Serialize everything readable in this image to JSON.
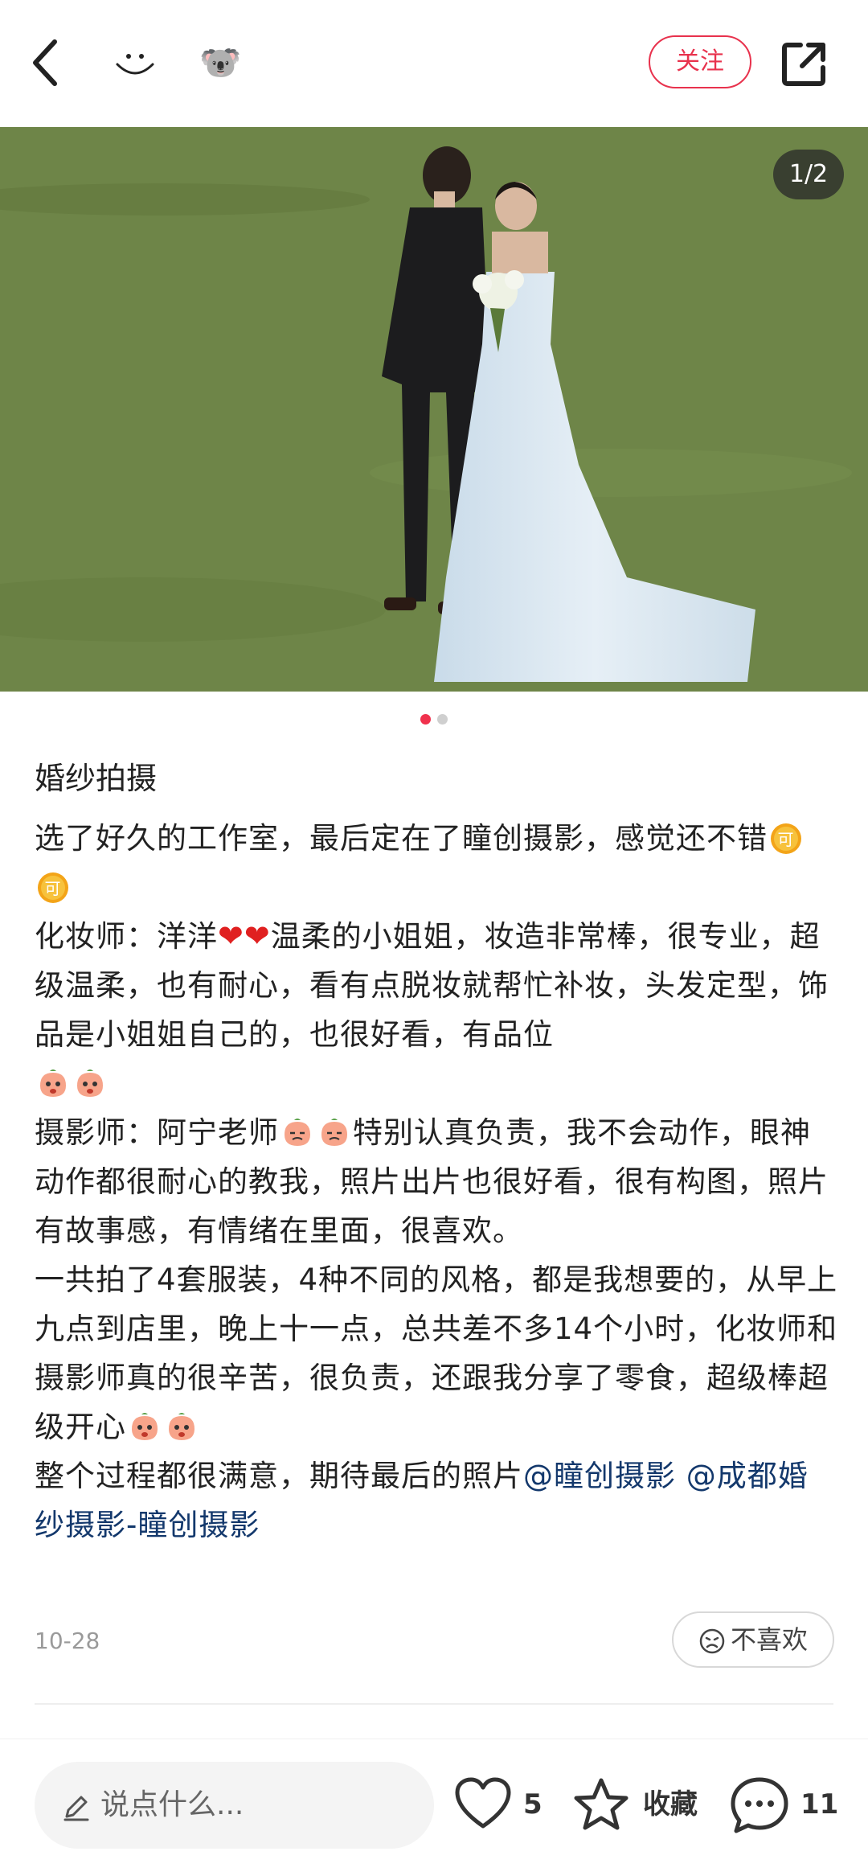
{
  "header": {
    "follow_label": "关注",
    "icons": {
      "back": "back-arrow-icon",
      "face": "smile-face-icon",
      "koala": "koala-emoji-icon",
      "share": "share-icon"
    }
  },
  "photo": {
    "counter": "1/2",
    "current_index": 1,
    "total": 2,
    "description_colors": {
      "grass": "#6d8446",
      "dress": "#dfeaf3",
      "suit": "#1c1c1e"
    }
  },
  "post": {
    "title": "婚纱拍摄",
    "para1": "选了好久的工作室，最后定在了瞳创摄影，感觉还不错",
    "para2a": "化妆师：洋洋",
    "para2b": "温柔的小姐姐，妆造非常棒，很专业，超级温柔，也有耐心，看有点脱妆就帮忙补妆，头发定型，饰品是小姐姐自己的，也很好看，有品位",
    "para3a": "摄影师：阿宁老师",
    "para3b": "特别认真负责，我不会动作，眼神动作都很耐心的教我，照片出片也很好看，很有构图，照片有故事感，有情绪在里面，很喜欢。",
    "para4": "一共拍了4套服装，4种不同的风格，都是我想要的，从早上九点到店里，晚上十一点，总共差不多14个小时，化妆师和摄影师真的很辛苦，很负责，还跟我分享了零食，超级棒超级开心",
    "para5": "整个过程都很满意，期待最后的照片",
    "mention1": "@瞳创摄影",
    "mention2": "@成都婚纱摄影-瞳创摄影",
    "date": "10-28",
    "dislike_label": "不喜欢"
  },
  "bottom": {
    "comment_placeholder": "说点什么...",
    "likes": "5",
    "collect_label": "收藏",
    "comments": "11"
  },
  "colors": {
    "accent": "#e8324d",
    "mention": "#13386c",
    "dot_active": "#f0314d"
  }
}
